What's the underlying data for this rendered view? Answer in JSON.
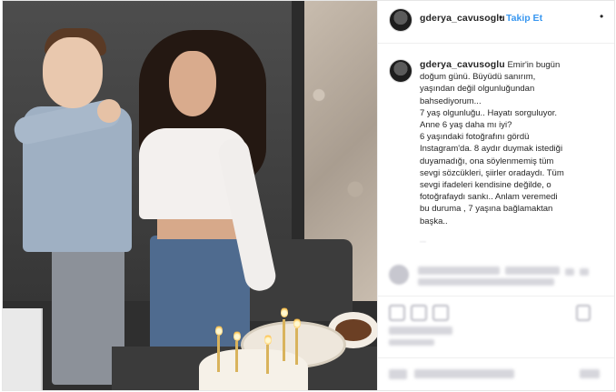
{
  "post": {
    "author": "gderya_cavusoglu",
    "separator": "•",
    "follow_label": "Takip Et",
    "more_label": "•",
    "caption": "Emir'in bugün\ndoğum günü. Büyüdü sanırım,\nyaşından değil olgunluğundan\nbahsediyorum...\n7 yaş olgunluğu.. Hayatı sorguluyor.\nAnne 6 yaş daha mı iyi?\n6 yaşındaki fotoğrafını gördü\nInstagram'da. 8 aydır duymak istediği\nduyamadığı, ona söylenmemiş tüm\nsevgi sözcükleri, şiirler oradaydı. Tüm\nsevgi ifadeleri kendisine değilde, o\nfotoğrafaydı sankı.. Anlam veremedi\nbu duruma , 7 yaşına bağlamaktan\nbaşka..",
    "extra_label": "---"
  },
  "icons": {
    "avatar": "profile-avatar",
    "like": "heart-icon",
    "comment": "comment-icon",
    "share": "share-icon",
    "save": "bookmark-icon"
  },
  "colors": {
    "follow": "#3897f0",
    "text": "#262626",
    "border": "#efefef"
  }
}
